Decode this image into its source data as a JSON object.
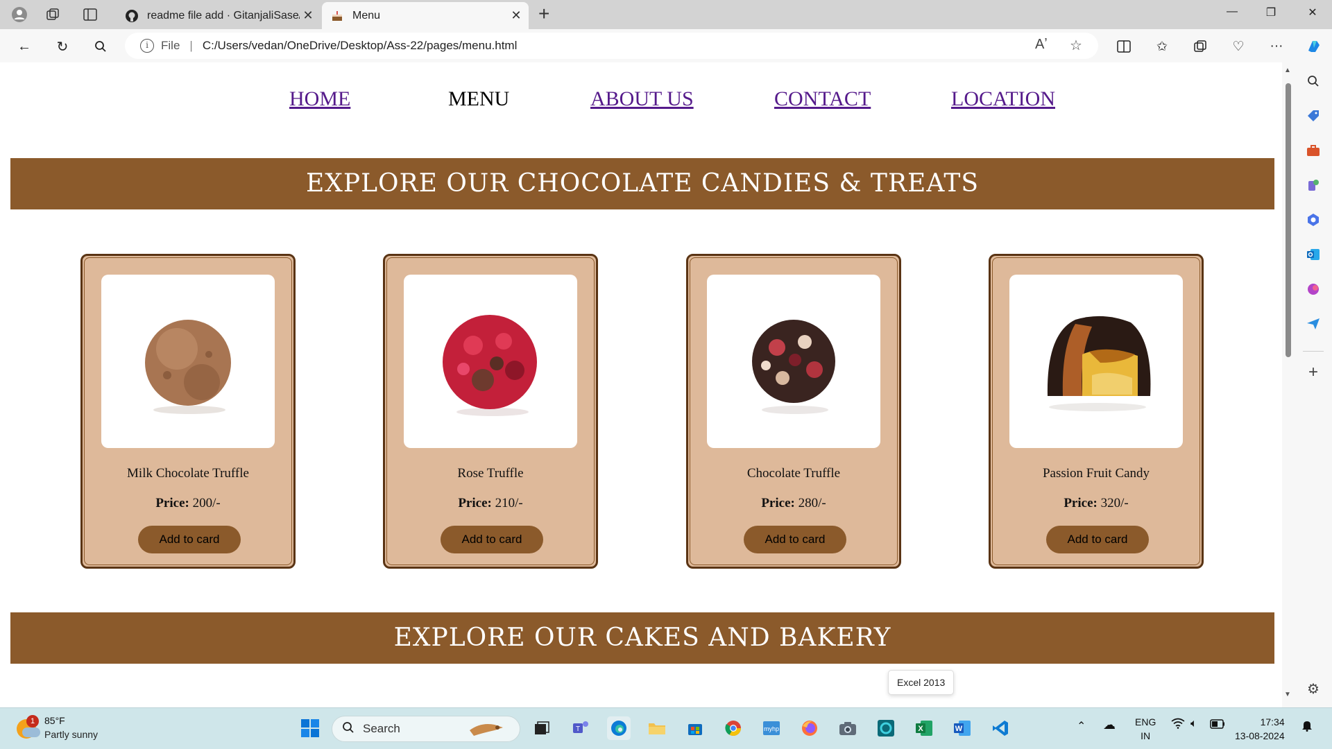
{
  "browser": {
    "tabs": [
      {
        "title": "readme file add · GitanjaliSase/A",
        "icon": "github-icon"
      },
      {
        "title": "Menu",
        "icon": "cake-icon"
      }
    ],
    "address_label": "File",
    "url": "C:/Users/vedan/OneDrive/Desktop/Ass-22/pages/menu.html"
  },
  "page": {
    "nav": [
      "HOME",
      "MENU",
      "ABOUT US",
      "CONTACT",
      "LOCATION"
    ],
    "banner1": "EXPLORE OUR CHOCOLATE CANDIES & TREATS",
    "banner2": "EXPLORE OUR CAKES AND BAKERY",
    "price_label": "Price:",
    "button_label": "Add to card",
    "products": [
      {
        "name": "Milk Chocolate Truffle",
        "price": "200/-",
        "image": "milk-chocolate-truffle"
      },
      {
        "name": "Rose Truffle",
        "price": "210/-",
        "image": "rose-truffle"
      },
      {
        "name": "Chocolate Truffle",
        "price": "280/-",
        "image": "chocolate-truffle"
      },
      {
        "name": "Passion Fruit Candy",
        "price": "320/-",
        "image": "passion-fruit-candy"
      }
    ]
  },
  "tooltip": "Excel 2013",
  "taskbar": {
    "weather_temp": "85°F",
    "weather_cond": "Partly sunny",
    "weather_badge": "1",
    "search_label": "Search",
    "lang_top": "ENG",
    "lang_bottom": "IN",
    "time": "17:34",
    "date": "13-08-2024"
  },
  "colors": {
    "banner": "#8b5a2b",
    "card_bg": "#deb99a",
    "card_border": "#5a3414",
    "nav_link": "#551a8b"
  }
}
